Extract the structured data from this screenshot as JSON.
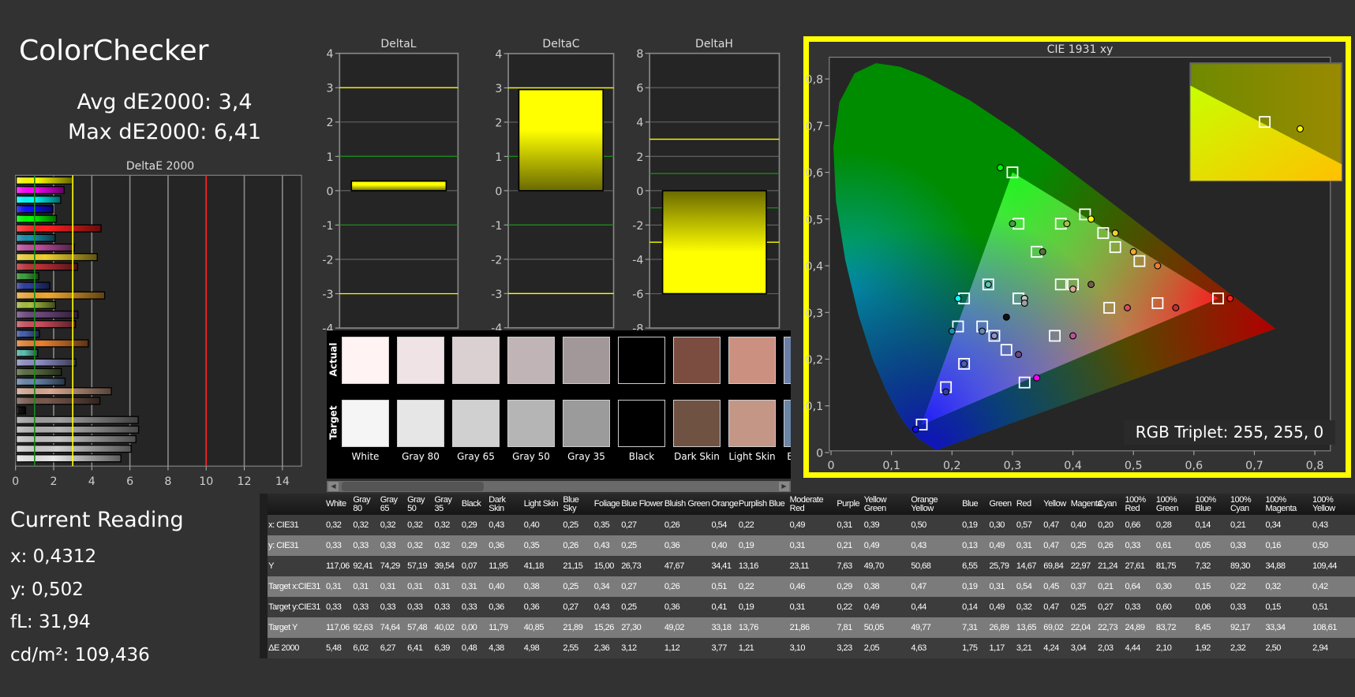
{
  "title": "ColorChecker",
  "stats": {
    "avg": "Avg dE2000: 3,4",
    "max": "Max dE2000: 6,41"
  },
  "current_reading": {
    "heading": "Current Reading",
    "x": "x: 0,4312",
    "y": "y: 0,502",
    "fl": "fL: 31,94",
    "cdm2": "cd/m²: 109,436"
  },
  "colors": {
    "accent_yellow": "#ffff00",
    "threshold_green": "#1a8a1a",
    "threshold_red": "#ff2020",
    "panel_bg": "#252525"
  },
  "deltaE_chart": {
    "title": "DeltaE 2000",
    "xlim": [
      0,
      15
    ],
    "ticks": [
      "0",
      "2",
      "4",
      "6",
      "8",
      "10",
      "12",
      "14"
    ],
    "green_line": 1,
    "yellow_line": 3,
    "red_line": 10
  },
  "delta_charts": [
    {
      "title": "DeltaL",
      "range": [
        -4,
        4
      ],
      "step": 1,
      "value": 0.28,
      "yellow_lines": [
        3,
        -3
      ],
      "green_lines": [
        1,
        -1
      ]
    },
    {
      "title": "DeltaC",
      "range": [
        -4,
        4
      ],
      "step": 1,
      "value": 2.95,
      "yellow_lines": [
        3,
        -3
      ],
      "green_lines": [
        1,
        -1
      ]
    },
    {
      "title": "DeltaH",
      "range": [
        -8,
        8
      ],
      "step": 2,
      "value": -6.0,
      "yellow_lines": [
        3,
        -3
      ],
      "green_lines": [
        1,
        -1
      ]
    }
  ],
  "swatches": {
    "actual_label": "Actual",
    "target_label": "Target",
    "items": [
      {
        "name": "White",
        "actual": "#fff3f3",
        "target": "#f5f5f5"
      },
      {
        "name": "Gray 80",
        "actual": "#efe3e5",
        "target": "#e6e6e6"
      },
      {
        "name": "Gray 65",
        "actual": "#dacfd1",
        "target": "#d0d0d0"
      },
      {
        "name": "Gray 50",
        "actual": "#c1b4b6",
        "target": "#b5b5b5"
      },
      {
        "name": "Gray 35",
        "actual": "#a39899",
        "target": "#9b9b9b"
      },
      {
        "name": "Black",
        "actual": "#000000",
        "target": "#000000"
      },
      {
        "name": "Dark Skin",
        "actual": "#7b4d40",
        "target": "#705243"
      },
      {
        "name": "Light Skin",
        "actual": "#cc9080",
        "target": "#c49686"
      },
      {
        "name": "Blue Sky",
        "actual": "#6b80a8",
        "target": "#6a86a8"
      }
    ]
  },
  "cie": {
    "title": "CIE 1931 xy",
    "xticks": [
      "0",
      "0,1",
      "0,2",
      "0,3",
      "0,4",
      "0,5",
      "0,6",
      "0,7",
      "0,8"
    ],
    "yticks": [
      "0",
      "0,1",
      "0,2",
      "0,3",
      "0,4",
      "0,5",
      "0,6",
      "0,7",
      "0,8"
    ],
    "target_gamut": {
      "red": [
        0.64,
        0.33
      ],
      "green": [
        0.3,
        0.6
      ],
      "blue": [
        0.15,
        0.06
      ]
    },
    "rgb_triplet": "RGB Triplet: 255, 255, 0"
  },
  "table": {
    "row_labels": [
      "x: CIE31",
      "y: CIE31",
      "Y",
      "Target x:CIE31",
      "Target y:CIE31",
      "Target Y",
      "ΔE 2000"
    ],
    "patches": [
      {
        "name": "White",
        "x": "0,32",
        "y": "0,33",
        "Y": "117,06",
        "tx": "0,31",
        "ty": "0,33",
        "tY": "117,06",
        "de": "5,48",
        "color": "#e8e8e8"
      },
      {
        "name": "Gray 80",
        "x": "0,32",
        "y": "0,33",
        "Y": "92,41",
        "tx": "0,31",
        "ty": "0,33",
        "tY": "92,63",
        "de": "6,02",
        "color": "#d0d0d0"
      },
      {
        "name": "Gray 65",
        "x": "0,32",
        "y": "0,33",
        "Y": "74,29",
        "tx": "0,31",
        "ty": "0,33",
        "tY": "74,64",
        "de": "6,27",
        "color": "#c4c4c4"
      },
      {
        "name": "Gray 50",
        "x": "0,32",
        "y": "0,32",
        "Y": "57,19",
        "tx": "0,31",
        "ty": "0,33",
        "tY": "57,48",
        "de": "6,41",
        "color": "#b4b4b4"
      },
      {
        "name": "Gray 35",
        "x": "0,32",
        "y": "0,32",
        "Y": "39,54",
        "tx": "0,31",
        "ty": "0,33",
        "tY": "40,02",
        "de": "6,39",
        "color": "#a0a0a0"
      },
      {
        "name": "Black",
        "x": "0,29",
        "y": "0,29",
        "Y": "0,07",
        "tx": "0,31",
        "ty": "0,33",
        "tY": "0,00",
        "de": "0,48",
        "color": "#111111"
      },
      {
        "name": "Dark Skin",
        "x": "0,43",
        "y": "0,36",
        "Y": "11,95",
        "tx": "0,40",
        "ty": "0,36",
        "tY": "11,79",
        "de": "4,38",
        "color": "#7a5a4e"
      },
      {
        "name": "Light Skin",
        "x": "0,40",
        "y": "0,35",
        "Y": "41,18",
        "tx": "0,38",
        "ty": "0,36",
        "tY": "40,85",
        "de": "4,98",
        "color": "#d8a890"
      },
      {
        "name": "Blue Sky",
        "x": "0,25",
        "y": "0,26",
        "Y": "21,15",
        "tx": "0,25",
        "ty": "0,27",
        "tY": "21,89",
        "de": "2,55",
        "color": "#6a88b0"
      },
      {
        "name": "Foliage",
        "x": "0,35",
        "y": "0,43",
        "Y": "15,00",
        "tx": "0,34",
        "ty": "0,43",
        "tY": "15,26",
        "de": "2,36",
        "color": "#5a7040"
      },
      {
        "name": "Blue Flower",
        "x": "0,27",
        "y": "0,25",
        "Y": "26,73",
        "tx": "0,27",
        "ty": "0,25",
        "tY": "27,30",
        "de": "3,12",
        "color": "#9090c8"
      },
      {
        "name": "Bluish Green",
        "x": "0,26",
        "y": "0,36",
        "Y": "47,67",
        "tx": "0,26",
        "ty": "0,36",
        "tY": "49,02",
        "de": "1,12",
        "color": "#60c0b0"
      },
      {
        "name": "Orange",
        "x": "0,54",
        "y": "0,40",
        "Y": "34,41",
        "tx": "0,51",
        "ty": "0,41",
        "tY": "33,18",
        "de": "3,77",
        "color": "#e88030"
      },
      {
        "name": "Purplish Blue",
        "x": "0,22",
        "y": "0,19",
        "Y": "13,16",
        "tx": "0,22",
        "ty": "0,19",
        "tY": "13,76",
        "de": "1,21",
        "color": "#4a60b0"
      },
      {
        "name": "Moderate Red",
        "x": "0,49",
        "y": "0,31",
        "Y": "23,11",
        "tx": "0,46",
        "ty": "0,31",
        "tY": "21,86",
        "de": "3,10",
        "color": "#d05060"
      },
      {
        "name": "Purple",
        "x": "0,31",
        "y": "0,21",
        "Y": "7,63",
        "tx": "0,29",
        "ty": "0,22",
        "tY": "7,81",
        "de": "3,23",
        "color": "#704880"
      },
      {
        "name": "Yellow Green",
        "x": "0,39",
        "y": "0,49",
        "Y": "49,70",
        "tx": "0,38",
        "ty": "0,49",
        "tY": "50,05",
        "de": "2,05",
        "color": "#a8c040"
      },
      {
        "name": "Orange Yellow",
        "x": "0,50",
        "y": "0,43",
        "Y": "50,68",
        "tx": "0,47",
        "ty": "0,44",
        "tY": "49,77",
        "de": "4,63",
        "color": "#f0a830"
      },
      {
        "name": "Blue",
        "x": "0,19",
        "y": "0,13",
        "Y": "6,55",
        "tx": "0,19",
        "ty": "0,14",
        "tY": "7,31",
        "de": "1,75",
        "color": "#3040a0"
      },
      {
        "name": "Green",
        "x": "0,30",
        "y": "0,49",
        "Y": "25,79",
        "tx": "0,31",
        "ty": "0,49",
        "tY": "26,89",
        "de": "1,17",
        "color": "#40a040"
      },
      {
        "name": "Red",
        "x": "0,57",
        "y": "0,31",
        "Y": "14,67",
        "tx": "0,54",
        "ty": "0,32",
        "tY": "13,65",
        "de": "3,21",
        "color": "#c03038"
      },
      {
        "name": "Yellow",
        "x": "0,47",
        "y": "0,47",
        "Y": "69,84",
        "tx": "0,45",
        "ty": "0,47",
        "tY": "69,02",
        "de": "4,24",
        "color": "#f0d030"
      },
      {
        "name": "Magenta",
        "x": "0,40",
        "y": "0,25",
        "Y": "22,97",
        "tx": "0,37",
        "ty": "0,25",
        "tY": "22,04",
        "de": "3,04",
        "color": "#c050a0"
      },
      {
        "name": "Cyan",
        "x": "0,20",
        "y": "0,26",
        "Y": "21,24",
        "tx": "0,21",
        "ty": "0,27",
        "tY": "22,73",
        "de": "2,03",
        "color": "#1890b0"
      },
      {
        "name": "100% Red",
        "x": "0,66",
        "y": "0,33",
        "Y": "27,61",
        "tx": "0,64",
        "ty": "0,33",
        "tY": "24,89",
        "de": "4,44",
        "color": "#ff2020"
      },
      {
        "name": "100% Green",
        "x": "0,28",
        "y": "0,61",
        "Y": "81,75",
        "tx": "0,30",
        "ty": "0,60",
        "tY": "83,72",
        "de": "2,10",
        "color": "#00ff00"
      },
      {
        "name": "100% Blue",
        "x": "0,14",
        "y": "0,05",
        "Y": "7,32",
        "tx": "0,15",
        "ty": "0,06",
        "tY": "8,45",
        "de": "1,92",
        "color": "#1010ff"
      },
      {
        "name": "100% Cyan",
        "x": "0,21",
        "y": "0,33",
        "Y": "89,30",
        "tx": "0,22",
        "ty": "0,33",
        "tY": "92,17",
        "de": "2,32",
        "color": "#00ffff"
      },
      {
        "name": "100% Magenta",
        "x": "0,34",
        "y": "0,16",
        "Y": "34,88",
        "tx": "0,32",
        "ty": "0,15",
        "tY": "33,34",
        "de": "2,50",
        "color": "#ff00ff"
      },
      {
        "name": "100% Yellow",
        "x": "0,43",
        "y": "0,50",
        "Y": "109,44",
        "tx": "0,42",
        "ty": "0,51",
        "tY": "108,61",
        "de": "2,94",
        "color": "#ffff00"
      }
    ]
  }
}
